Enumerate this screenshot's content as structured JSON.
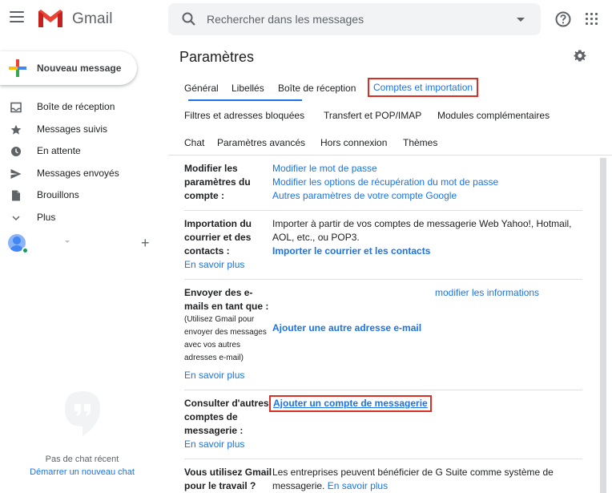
{
  "app": {
    "name": "Gmail"
  },
  "colors": {
    "link": "#1a73e8",
    "highlight": "#d93025",
    "text": "#202124"
  },
  "search": {
    "placeholder": "Rechercher dans les messages"
  },
  "sidebar": {
    "compose_label": "Nouveau message",
    "items": [
      {
        "label": "Boîte de réception",
        "icon": "inbox-icon"
      },
      {
        "label": "Messages suivis",
        "icon": "star-icon"
      },
      {
        "label": "En attente",
        "icon": "clock-icon"
      },
      {
        "label": "Messages envoyés",
        "icon": "send-icon"
      },
      {
        "label": "Brouillons",
        "icon": "draft-icon"
      },
      {
        "label": "Plus",
        "icon": "chevron-down-icon"
      }
    ],
    "chat": {
      "add": "+",
      "empty_text": "Pas de chat récent",
      "start_link": "Démarrer un nouveau chat"
    }
  },
  "settings": {
    "title": "Paramètres",
    "tabs_row1": [
      "Général",
      "Libellés",
      "Boîte de réception",
      "Comptes et importation"
    ],
    "tabs_row2": [
      "Filtres et adresses bloquées",
      "Transfert et POP/IMAP",
      "Modules complémentaires"
    ],
    "tabs_row3": [
      "Chat",
      "Paramètres avancés",
      "Hors connexion",
      "Thèmes"
    ],
    "active_tab": "Comptes et importation",
    "sections": {
      "modify": {
        "label": "Modifier les paramètres du compte :",
        "links": [
          "Modifier le mot de passe",
          "Modifier les options de récupération du mot de passe",
          "Autres paramètres de votre compte Google"
        ]
      },
      "import": {
        "label": "Importation du courrier et des contacts :",
        "learn_more": "En savoir plus",
        "text": "Importer à partir de vos comptes de messagerie Web Yahoo!, Hotmail, AOL, etc., ou POP3.",
        "action": "Importer le courrier et les contacts"
      },
      "send_as": {
        "label": "Envoyer des e-mails en tant que :",
        "sub": "(Utilisez Gmail pour envoyer des messages avec vos autres adresses e-mail)",
        "learn_more": "En savoir plus",
        "edit_link": "modifier les informations",
        "action": "Ajouter une autre adresse e-mail"
      },
      "check_mail": {
        "label": "Consulter d'autres comptes de messagerie :",
        "learn_more": "En savoir plus",
        "action": "Ajouter un compte de messagerie"
      },
      "gsuite": {
        "label": "Vous utilisez Gmail pour le travail ?",
        "text": "Les entreprises peuvent bénéficier de G Suite comme système de messagerie.",
        "learn_more": "En savoir plus"
      }
    }
  }
}
